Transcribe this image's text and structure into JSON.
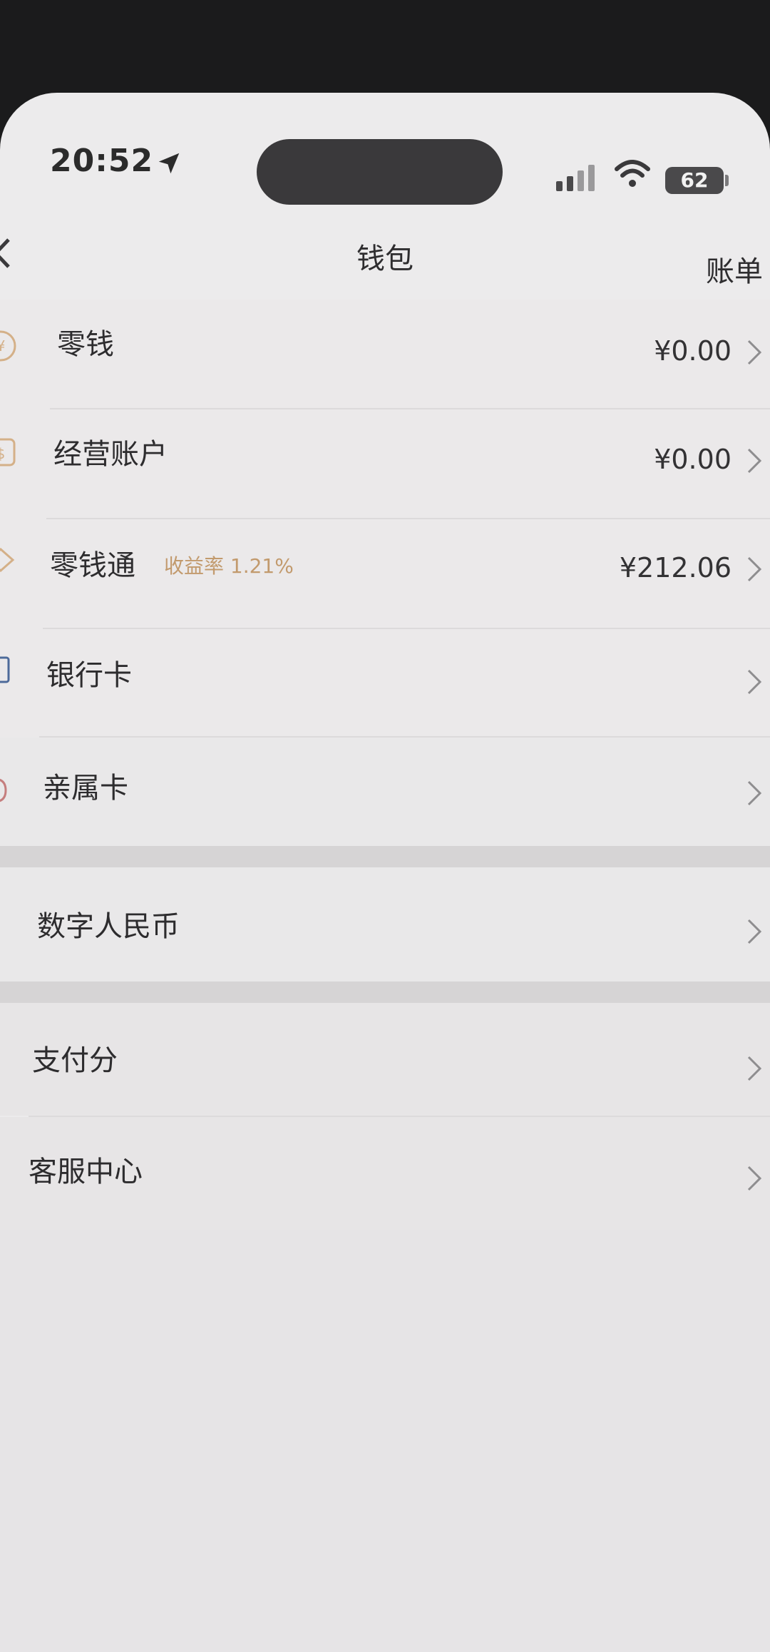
{
  "status_bar": {
    "time": "20:52",
    "battery": "62"
  },
  "nav": {
    "title": "钱包",
    "right_action": "账单"
  },
  "wallet_items": [
    {
      "label": "零钱",
      "value": "¥0.00",
      "icon": "coin-icon"
    },
    {
      "label": "经营账户",
      "value": "¥0.00",
      "icon": "store-icon"
    },
    {
      "label": "零钱通",
      "sub": "收益率 1.21%",
      "value": "¥212.06",
      "icon": "wealth-icon"
    },
    {
      "label": "银行卡",
      "value": "",
      "icon": "card-icon"
    },
    {
      "label": "亲属卡",
      "value": "",
      "icon": "family-card-icon"
    }
  ],
  "digital_rmb": {
    "label": "数字人民币"
  },
  "services": [
    {
      "label": "支付分"
    },
    {
      "label": "客服中心"
    }
  ],
  "colors": {
    "accent_gold": "#c29a6d",
    "background": "#ecebec",
    "text": "#2d2c2e"
  }
}
